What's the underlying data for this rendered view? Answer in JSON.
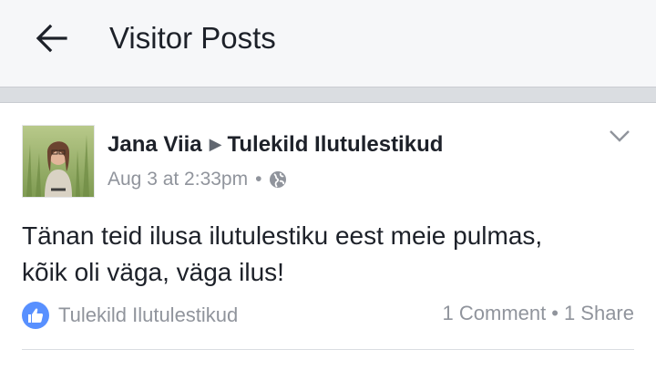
{
  "header": {
    "title": "Visitor Posts",
    "back_icon": "arrow-left-icon"
  },
  "post": {
    "author": "Jana Viia",
    "target": "Tulekild Ilutulestikud",
    "timestamp": "Aug 3 at 2:33pm",
    "separator": "•",
    "privacy_icon": "globe-icon",
    "text_line1": "Tänan teid ilusa ilutulestiku eest meie pulmas,",
    "text_line2": "kõik oli väga, väga ilus!",
    "likes": {
      "icon": "thumbs-up-icon",
      "label": "Tulekild Ilutulestikud"
    },
    "comments": "1 Comment",
    "shares": "1 Share"
  },
  "colors": {
    "header_bg": "#f6f7f9",
    "band": "#dadde1",
    "like_blue": "#5890ff",
    "muted": "#90949c",
    "text": "#1d2129"
  }
}
